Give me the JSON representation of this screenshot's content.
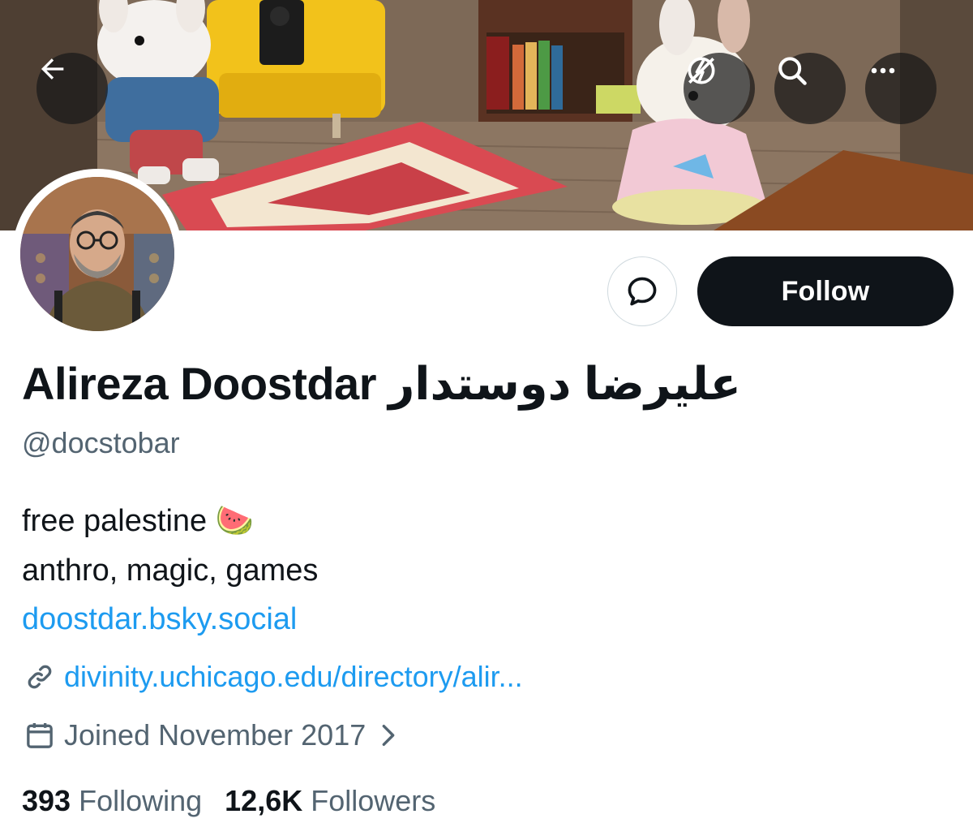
{
  "profile": {
    "display_name": "Alireza Doostdar علیرضا دوستدار",
    "handle": "@docstobar",
    "bio": {
      "line1": "free palestine 🍉",
      "line2": "anthro, magic, games",
      "link": "doostdar.bsky.social"
    },
    "website": "divinity.uchicago.edu/directory/alir...",
    "joined": "Joined November 2017",
    "stats": {
      "following_count": "393",
      "following_label": "Following",
      "followers_count": "12,6K",
      "followers_label": "Followers"
    }
  },
  "actions": {
    "follow_label": "Follow"
  },
  "icons": {
    "back": "arrow-left-icon",
    "lightning": "lightning-slash-icon",
    "search": "search-icon",
    "more": "more-dots-icon",
    "message": "message-bubble-icon",
    "link": "link-icon",
    "calendar": "calendar-icon",
    "chevron": "chevron-right-icon"
  },
  "colors": {
    "link": "#1d9bf0",
    "muted": "#536471",
    "text": "#0f1419",
    "follow_bg": "#0f1419"
  }
}
